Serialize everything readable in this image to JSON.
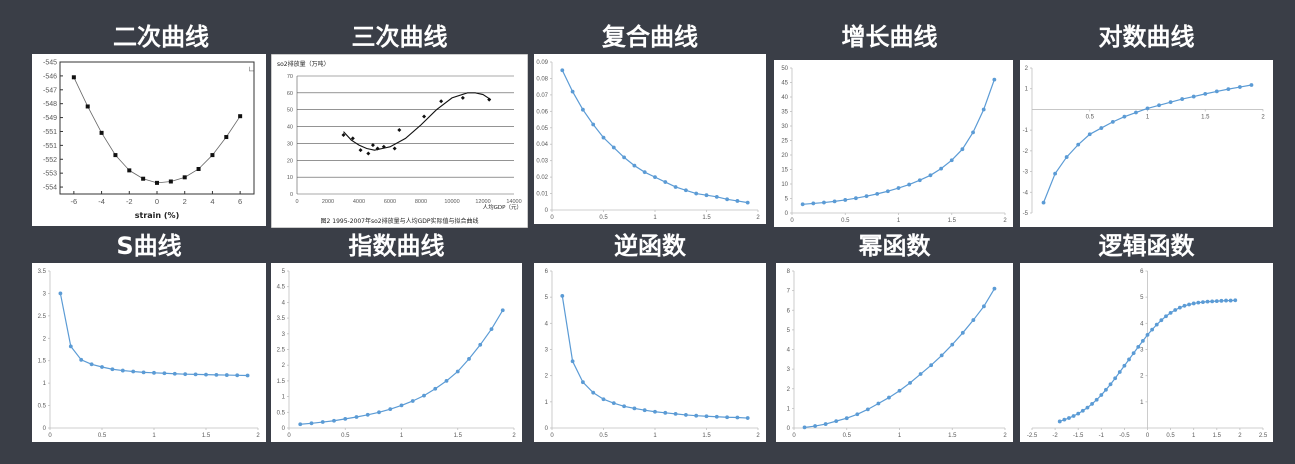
{
  "titles": [
    "二次曲线",
    "三次曲线",
    "复合曲线",
    "增长曲线",
    "对数曲线",
    "S曲线",
    "指数曲线",
    "逆函数",
    "幂函数",
    "逻辑函数"
  ],
  "colors": {
    "background": "#3a3e47",
    "series": "#5b9bd5",
    "title": "#ffffff"
  },
  "chart_data": [
    {
      "type": "line",
      "style": "black-square",
      "xlabel": "strain (%)",
      "ylabel": "",
      "xlim": [
        -7,
        7
      ],
      "ylim": [
        -554.5,
        -545
      ],
      "xticks": [
        -6,
        -4,
        -2,
        0,
        2,
        4,
        6
      ],
      "yticks": [
        -545,
        -546,
        -547,
        -548,
        -549,
        -550,
        -551,
        -552,
        -553,
        -554
      ],
      "yticklabels": [
        "-545",
        "-546",
        "-547",
        "-548",
        "-549",
        "-551",
        "-551",
        "-552",
        "-553",
        "-554"
      ],
      "corner_mark": "∟",
      "x": [
        -6,
        -5,
        -4,
        -3,
        -2,
        -1,
        0,
        1,
        2,
        3,
        4,
        5,
        6
      ],
      "y": [
        -546.1,
        -548.2,
        -550.1,
        -551.7,
        -552.8,
        -553.4,
        -553.7,
        -553.6,
        -553.3,
        -552.7,
        -551.7,
        -550.4,
        -548.9
      ]
    },
    {
      "type": "scatter",
      "style": "textbook",
      "title": "so2排放量（万吨）",
      "caption": "图2   1995-2007年so2排放量与人均GDP实际值与拟合曲线",
      "xlabel": "人均GDP（元）",
      "xlim": [
        0,
        14000
      ],
      "ylim": [
        0,
        70
      ],
      "xticks": [
        0,
        2000,
        4000,
        6000,
        8000,
        10000,
        12000,
        14000
      ],
      "yticks": [
        0,
        10,
        20,
        30,
        40,
        50,
        60,
        70
      ],
      "x": [
        3000,
        3600,
        4100,
        4600,
        4900,
        5200,
        5600,
        6300,
        6600,
        8200,
        9300,
        10700,
        12400
      ],
      "y": [
        35,
        33,
        26,
        24,
        29,
        27,
        28,
        27,
        38,
        46,
        55,
        57,
        56
      ],
      "fit": {
        "x": [
          3000,
          3500,
          4000,
          4500,
          5000,
          5500,
          6000,
          7000,
          8000,
          9000,
          10000,
          11000,
          11500,
          12000,
          12500
        ],
        "y": [
          37,
          32,
          29,
          27,
          26,
          27,
          28,
          33,
          41,
          50,
          57,
          60,
          60,
          59,
          56
        ]
      }
    },
    {
      "type": "line",
      "style": "excel",
      "xlim": [
        0,
        2
      ],
      "ylim": [
        0,
        0.09
      ],
      "xticks": [
        0,
        0.5,
        1,
        1.5,
        2
      ],
      "yticks": [
        0,
        0.01,
        0.02,
        0.03,
        0.04,
        0.05,
        0.06,
        0.07,
        0.08,
        0.09
      ],
      "x": [
        0.1,
        0.2,
        0.3,
        0.4,
        0.5,
        0.6,
        0.7,
        0.8,
        0.9,
        1,
        1.1,
        1.2,
        1.3,
        1.4,
        1.5,
        1.6,
        1.7,
        1.8,
        1.9
      ],
      "y": [
        0.085,
        0.072,
        0.061,
        0.052,
        0.044,
        0.038,
        0.032,
        0.027,
        0.023,
        0.02,
        0.017,
        0.014,
        0.012,
        0.01,
        0.009,
        0.008,
        0.0065,
        0.0055,
        0.0045
      ]
    },
    {
      "type": "line",
      "style": "excel",
      "xlim": [
        0,
        2
      ],
      "ylim": [
        0,
        50
      ],
      "xticks": [
        0,
        0.5,
        1,
        1.5,
        2
      ],
      "yticks": [
        0,
        5,
        10,
        15,
        20,
        25,
        30,
        35,
        40,
        45,
        50
      ],
      "x": [
        0.1,
        0.2,
        0.3,
        0.4,
        0.5,
        0.6,
        0.7,
        0.8,
        0.9,
        1,
        1.1,
        1.2,
        1.3,
        1.4,
        1.5,
        1.6,
        1.7,
        1.8,
        1.9
      ],
      "y": [
        3,
        3.3,
        3.6,
        4,
        4.5,
        5.1,
        5.8,
        6.6,
        7.5,
        8.6,
        9.8,
        11.3,
        13,
        15.3,
        18.2,
        22,
        27.8,
        35.7,
        46
      ]
    },
    {
      "type": "line",
      "style": "excel-cross",
      "xlim": [
        0,
        2
      ],
      "ylim": [
        -5,
        2
      ],
      "xticks": [
        0.5,
        1,
        1.5,
        2
      ],
      "yticks": [
        2,
        1,
        -1,
        -2,
        -3,
        -4,
        -5
      ],
      "x": [
        0.1,
        0.2,
        0.3,
        0.4,
        0.5,
        0.6,
        0.7,
        0.8,
        0.9,
        1,
        1.1,
        1.2,
        1.3,
        1.4,
        1.5,
        1.6,
        1.7,
        1.8,
        1.9
      ],
      "y": [
        -4.5,
        -3.1,
        -2.3,
        -1.7,
        -1.2,
        -0.9,
        -0.6,
        -0.35,
        -0.15,
        0.05,
        0.2,
        0.35,
        0.5,
        0.62,
        0.75,
        0.87,
        0.98,
        1.08,
        1.18
      ]
    },
    {
      "type": "line",
      "style": "excel",
      "xlim": [
        0,
        2
      ],
      "ylim": [
        0,
        3.5
      ],
      "xticks": [
        0,
        0.5,
        1,
        1.5,
        2
      ],
      "yticks": [
        0,
        0.5,
        1,
        1.5,
        2,
        2.5,
        3,
        3.5
      ],
      "x": [
        0.1,
        0.2,
        0.3,
        0.4,
        0.5,
        0.6,
        0.7,
        0.8,
        0.9,
        1,
        1.1,
        1.2,
        1.3,
        1.4,
        1.5,
        1.6,
        1.7,
        1.8,
        1.9
      ],
      "y": [
        3,
        1.82,
        1.52,
        1.42,
        1.36,
        1.31,
        1.28,
        1.26,
        1.24,
        1.23,
        1.22,
        1.21,
        1.2,
        1.195,
        1.19,
        1.185,
        1.18,
        1.175,
        1.17
      ]
    },
    {
      "type": "line",
      "style": "excel",
      "xlim": [
        0,
        2
      ],
      "ylim": [
        0,
        5
      ],
      "xticks": [
        0,
        0.5,
        1,
        1.5,
        2
      ],
      "yticks": [
        0,
        0.5,
        1,
        1.5,
        2,
        2.5,
        3,
        3.5,
        4,
        4.5,
        5
      ],
      "x": [
        0.1,
        0.2,
        0.3,
        0.4,
        0.5,
        0.6,
        0.7,
        0.8,
        0.9,
        1,
        1.1,
        1.2,
        1.3,
        1.4,
        1.5,
        1.6,
        1.7,
        1.8,
        1.9
      ],
      "y": [
        0.12,
        0.15,
        0.19,
        0.23,
        0.29,
        0.35,
        0.42,
        0.5,
        0.6,
        0.72,
        0.86,
        1.03,
        1.25,
        1.5,
        1.8,
        2.2,
        2.65,
        3.15,
        3.75
      ]
    },
    {
      "type": "line",
      "style": "excel",
      "xlim": [
        0,
        2
      ],
      "ylim": [
        0,
        6
      ],
      "xticks": [
        0,
        0.5,
        1,
        1.5,
        2
      ],
      "yticks": [
        0,
        1,
        2,
        3,
        4,
        5,
        6
      ],
      "x": [
        0.1,
        0.2,
        0.3,
        0.4,
        0.5,
        0.6,
        0.7,
        0.8,
        0.9,
        1,
        1.1,
        1.2,
        1.3,
        1.4,
        1.5,
        1.6,
        1.7,
        1.8,
        1.9
      ],
      "y": [
        5.05,
        2.55,
        1.75,
        1.35,
        1.1,
        0.95,
        0.83,
        0.75,
        0.68,
        0.62,
        0.58,
        0.54,
        0.5,
        0.47,
        0.45,
        0.43,
        0.41,
        0.4,
        0.38
      ]
    },
    {
      "type": "line",
      "style": "excel",
      "xlim": [
        0,
        2
      ],
      "ylim": [
        0,
        8
      ],
      "xticks": [
        0,
        0.5,
        1,
        1.5,
        2
      ],
      "yticks": [
        0,
        1,
        2,
        3,
        4,
        5,
        6,
        7,
        8
      ],
      "x": [
        0.1,
        0.2,
        0.3,
        0.4,
        0.5,
        0.6,
        0.7,
        0.8,
        0.9,
        1,
        1.1,
        1.2,
        1.3,
        1.4,
        1.5,
        1.6,
        1.7,
        1.8,
        1.9
      ],
      "y": [
        0.03,
        0.1,
        0.2,
        0.35,
        0.5,
        0.7,
        0.95,
        1.25,
        1.55,
        1.9,
        2.3,
        2.75,
        3.2,
        3.7,
        4.25,
        4.85,
        5.5,
        6.2,
        7.1
      ]
    },
    {
      "type": "line",
      "style": "excel-cross",
      "xlim": [
        -2.5,
        2.5
      ],
      "ylim": [
        0,
        6
      ],
      "xticks": [
        -2.5,
        -2,
        -1.5,
        -1,
        -0.5,
        0,
        0.5,
        1,
        1.5,
        2,
        2.5
      ],
      "yticks": [
        1,
        2,
        3,
        4,
        5,
        6
      ],
      "x": [
        -1.9,
        -1.8,
        -1.7,
        -1.6,
        -1.5,
        -1.4,
        -1.3,
        -1.2,
        -1.1,
        -1,
        -0.9,
        -0.8,
        -0.7,
        -0.6,
        -0.5,
        -0.4,
        -0.3,
        -0.2,
        -0.1,
        0,
        0.1,
        0.2,
        0.3,
        0.4,
        0.5,
        0.6,
        0.7,
        0.8,
        0.9,
        1,
        1.1,
        1.2,
        1.3,
        1.4,
        1.5,
        1.6,
        1.7,
        1.8,
        1.9
      ],
      "y": [
        0.25,
        0.32,
        0.38,
        0.46,
        0.55,
        0.66,
        0.78,
        0.92,
        1.08,
        1.26,
        1.46,
        1.67,
        1.9,
        2.14,
        2.38,
        2.62,
        2.86,
        3.1,
        3.33,
        3.56,
        3.76,
        3.95,
        4.12,
        4.27,
        4.4,
        4.51,
        4.6,
        4.67,
        4.72,
        4.76,
        4.79,
        4.81,
        4.83,
        4.84,
        4.85,
        4.86,
        4.87,
        4.87,
        4.88
      ]
    }
  ]
}
